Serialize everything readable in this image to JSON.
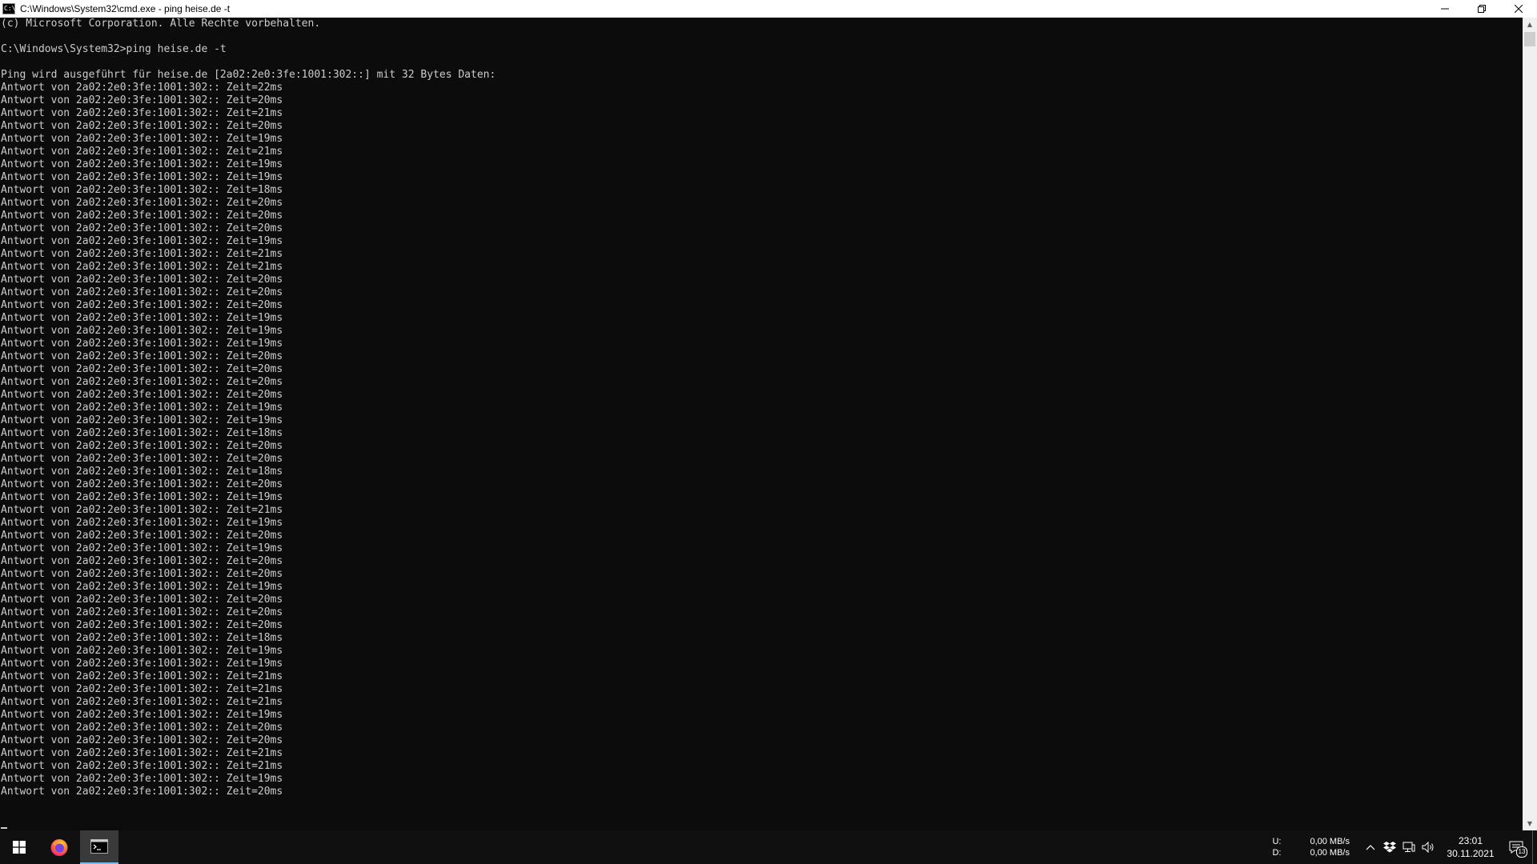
{
  "window": {
    "title": "C:\\Windows\\System32\\cmd.exe - ping  heise.de -t",
    "icon": "cmd-icon",
    "controls": [
      "minimize-icon",
      "restore-icon",
      "close-icon"
    ]
  },
  "console": {
    "lines": [
      "(c) Microsoft Corporation. Alle Rechte vorbehalten.",
      "",
      "C:\\Windows\\System32>ping heise.de -t",
      "",
      "Ping wird ausgeführt für heise.de [2a02:2e0:3fe:1001:302::] mit 32 Bytes Daten:",
      "Antwort von 2a02:2e0:3fe:1001:302:: Zeit=22ms",
      "Antwort von 2a02:2e0:3fe:1001:302:: Zeit=20ms",
      "Antwort von 2a02:2e0:3fe:1001:302:: Zeit=21ms",
      "Antwort von 2a02:2e0:3fe:1001:302:: Zeit=20ms",
      "Antwort von 2a02:2e0:3fe:1001:302:: Zeit=19ms",
      "Antwort von 2a02:2e0:3fe:1001:302:: Zeit=21ms",
      "Antwort von 2a02:2e0:3fe:1001:302:: Zeit=19ms",
      "Antwort von 2a02:2e0:3fe:1001:302:: Zeit=19ms",
      "Antwort von 2a02:2e0:3fe:1001:302:: Zeit=18ms",
      "Antwort von 2a02:2e0:3fe:1001:302:: Zeit=20ms",
      "Antwort von 2a02:2e0:3fe:1001:302:: Zeit=20ms",
      "Antwort von 2a02:2e0:3fe:1001:302:: Zeit=20ms",
      "Antwort von 2a02:2e0:3fe:1001:302:: Zeit=19ms",
      "Antwort von 2a02:2e0:3fe:1001:302:: Zeit=21ms",
      "Antwort von 2a02:2e0:3fe:1001:302:: Zeit=21ms",
      "Antwort von 2a02:2e0:3fe:1001:302:: Zeit=20ms",
      "Antwort von 2a02:2e0:3fe:1001:302:: Zeit=20ms",
      "Antwort von 2a02:2e0:3fe:1001:302:: Zeit=20ms",
      "Antwort von 2a02:2e0:3fe:1001:302:: Zeit=19ms",
      "Antwort von 2a02:2e0:3fe:1001:302:: Zeit=19ms",
      "Antwort von 2a02:2e0:3fe:1001:302:: Zeit=19ms",
      "Antwort von 2a02:2e0:3fe:1001:302:: Zeit=20ms",
      "Antwort von 2a02:2e0:3fe:1001:302:: Zeit=20ms",
      "Antwort von 2a02:2e0:3fe:1001:302:: Zeit=20ms",
      "Antwort von 2a02:2e0:3fe:1001:302:: Zeit=20ms",
      "Antwort von 2a02:2e0:3fe:1001:302:: Zeit=19ms",
      "Antwort von 2a02:2e0:3fe:1001:302:: Zeit=19ms",
      "Antwort von 2a02:2e0:3fe:1001:302:: Zeit=18ms",
      "Antwort von 2a02:2e0:3fe:1001:302:: Zeit=20ms",
      "Antwort von 2a02:2e0:3fe:1001:302:: Zeit=20ms",
      "Antwort von 2a02:2e0:3fe:1001:302:: Zeit=18ms",
      "Antwort von 2a02:2e0:3fe:1001:302:: Zeit=20ms",
      "Antwort von 2a02:2e0:3fe:1001:302:: Zeit=19ms",
      "Antwort von 2a02:2e0:3fe:1001:302:: Zeit=21ms",
      "Antwort von 2a02:2e0:3fe:1001:302:: Zeit=19ms",
      "Antwort von 2a02:2e0:3fe:1001:302:: Zeit=20ms",
      "Antwort von 2a02:2e0:3fe:1001:302:: Zeit=19ms",
      "Antwort von 2a02:2e0:3fe:1001:302:: Zeit=20ms",
      "Antwort von 2a02:2e0:3fe:1001:302:: Zeit=20ms",
      "Antwort von 2a02:2e0:3fe:1001:302:: Zeit=19ms",
      "Antwort von 2a02:2e0:3fe:1001:302:: Zeit=20ms",
      "Antwort von 2a02:2e0:3fe:1001:302:: Zeit=20ms",
      "Antwort von 2a02:2e0:3fe:1001:302:: Zeit=20ms",
      "Antwort von 2a02:2e0:3fe:1001:302:: Zeit=18ms",
      "Antwort von 2a02:2e0:3fe:1001:302:: Zeit=19ms",
      "Antwort von 2a02:2e0:3fe:1001:302:: Zeit=19ms",
      "Antwort von 2a02:2e0:3fe:1001:302:: Zeit=21ms",
      "Antwort von 2a02:2e0:3fe:1001:302:: Zeit=21ms",
      "Antwort von 2a02:2e0:3fe:1001:302:: Zeit=21ms",
      "Antwort von 2a02:2e0:3fe:1001:302:: Zeit=19ms",
      "Antwort von 2a02:2e0:3fe:1001:302:: Zeit=20ms",
      "Antwort von 2a02:2e0:3fe:1001:302:: Zeit=20ms",
      "Antwort von 2a02:2e0:3fe:1001:302:: Zeit=21ms",
      "Antwort von 2a02:2e0:3fe:1001:302:: Zeit=21ms",
      "Antwort von 2a02:2e0:3fe:1001:302:: Zeit=19ms",
      "Antwort von 2a02:2e0:3fe:1001:302:: Zeit=20ms"
    ]
  },
  "taskbar": {
    "buttons": [
      {
        "name": "start-button",
        "icon": "windows-logo-icon",
        "active": false
      },
      {
        "name": "firefox-button",
        "icon": "firefox-icon",
        "active": false
      },
      {
        "name": "cmd-button",
        "icon": "cmd-icon",
        "active": true
      }
    ],
    "net_speed": {
      "up_label": "U:",
      "down_label": "D:",
      "up_value": "0,00 MB/s",
      "down_value": "0,00 MB/s"
    },
    "tray_icons": [
      "chevron-up-icon",
      "dropbox-icon",
      "network-icon",
      "volume-icon"
    ],
    "clock": {
      "time": "23:01",
      "date": "30.11.2021"
    },
    "notifications": {
      "icon": "notification-icon",
      "count": "13"
    }
  },
  "colors": {
    "console_bg": "#0c0c0c",
    "console_fg": "#cccccc",
    "taskbar_bg": "#101010",
    "active_indicator": "#76b9ed"
  }
}
